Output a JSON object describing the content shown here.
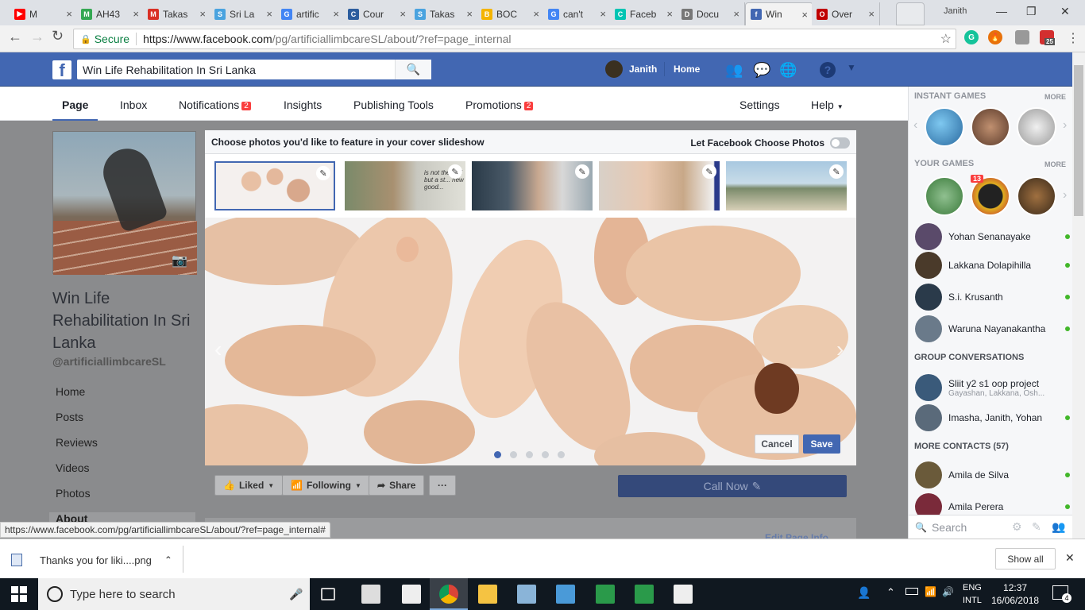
{
  "browser": {
    "tabs": [
      {
        "label": "M",
        "color": "#ff0000",
        "fav": "▶"
      },
      {
        "label": "AH43",
        "color": "#34a853",
        "fav": "M"
      },
      {
        "label": "Takas",
        "color": "#d93025",
        "fav": "M"
      },
      {
        "label": "Sri La",
        "color": "#4aa3df",
        "fav": "S"
      },
      {
        "label": "artific",
        "color": "#4285f4",
        "fav": "G"
      },
      {
        "label": "Cour",
        "color": "#2c5d9e",
        "fav": "C"
      },
      {
        "label": "Takas",
        "color": "#4aa3df",
        "fav": "S"
      },
      {
        "label": "BOC",
        "color": "#f4b400",
        "fav": "B"
      },
      {
        "label": "can't",
        "color": "#4285f4",
        "fav": "G"
      },
      {
        "label": "Faceb",
        "color": "#00c4b3",
        "fav": "C"
      },
      {
        "label": "Docu",
        "color": "#777777",
        "fav": "D"
      },
      {
        "label": "Win",
        "color": "#4267b2",
        "fav": "f"
      },
      {
        "label": "Over",
        "color": "#c00000",
        "fav": "O"
      }
    ],
    "window_user": "Janith",
    "secure_label": "Secure",
    "url_domain": "https://www.facebook.com",
    "url_path": "/pg/artificiallimbcareSL/about/?ref=page_internal",
    "ext_badge": "25"
  },
  "fb": {
    "search_value": "Win Life Rehabilitation In Sri Lanka",
    "user_name": "Janith",
    "home_label": "Home"
  },
  "pagenav": {
    "page": "Page",
    "inbox": "Inbox",
    "notifications": "Notifications",
    "notifications_count": "2",
    "insights": "Insights",
    "publishing": "Publishing Tools",
    "promotions": "Promotions",
    "promotions_count": "2",
    "settings": "Settings",
    "help": "Help"
  },
  "left": {
    "title": "Win Life Rehabilitation In Sri Lanka",
    "handle": "@artificiallimbcareSL",
    "nav": [
      "Home",
      "Posts",
      "Reviews",
      "Videos",
      "Photos",
      "About"
    ]
  },
  "slideshow": {
    "prompt": "Choose photos you'd like to feature in your cover slideshow",
    "auto_label": "Let Facebook Choose Photos",
    "cancel": "Cancel",
    "save": "Save",
    "thumb2_text": "is not the end but a st... new good..."
  },
  "actions": {
    "liked": "Liked",
    "following": "Following",
    "share": "Share",
    "more": "···",
    "call_now": "Call Now"
  },
  "status_url": "https://www.facebook.com/pg/artificiallimbcareSL/about/?ref=page_internal#",
  "edit_page_info": "Edit Page Info",
  "sidebar": {
    "instant_games": "INSTANT GAMES",
    "your_games": "YOUR GAMES",
    "more": "MORE",
    "game_badge": "13",
    "contacts": [
      {
        "name": "Yohan Senanayake",
        "color": "#5a4a6a"
      },
      {
        "name": "Lakkana Dolapihilla",
        "color": "#4a3a2a"
      },
      {
        "name": "S.i. Krusanth",
        "color": "#2a3a4a"
      },
      {
        "name": "Waruna Nayanakantha",
        "color": "#6a7a8a"
      }
    ],
    "group_header": "GROUP CONVERSATIONS",
    "groups": [
      {
        "name": "Sliit y2 s1 oop project",
        "sub": "Gayashan, Lakkana, Osh...",
        "color": "#3a5a7a"
      },
      {
        "name": "Imasha, Janith, Yohan",
        "sub": "",
        "color": "#5a6a7a"
      }
    ],
    "more_contacts": "MORE CONTACTS (57)",
    "more_list": [
      {
        "name": "Amila de Silva",
        "color": "#6a5a3a"
      },
      {
        "name": "Amila Perera",
        "color": "#7a2a3a"
      }
    ],
    "search_placeholder": "Search"
  },
  "downloads": {
    "file": "Thanks you for liki....png",
    "show_all": "Show all"
  },
  "taskbar": {
    "search_placeholder": "Type here to search",
    "lang1": "ENG",
    "lang2": "INTL",
    "time": "12:37",
    "date": "16/06/2018",
    "notif_count": "4"
  }
}
